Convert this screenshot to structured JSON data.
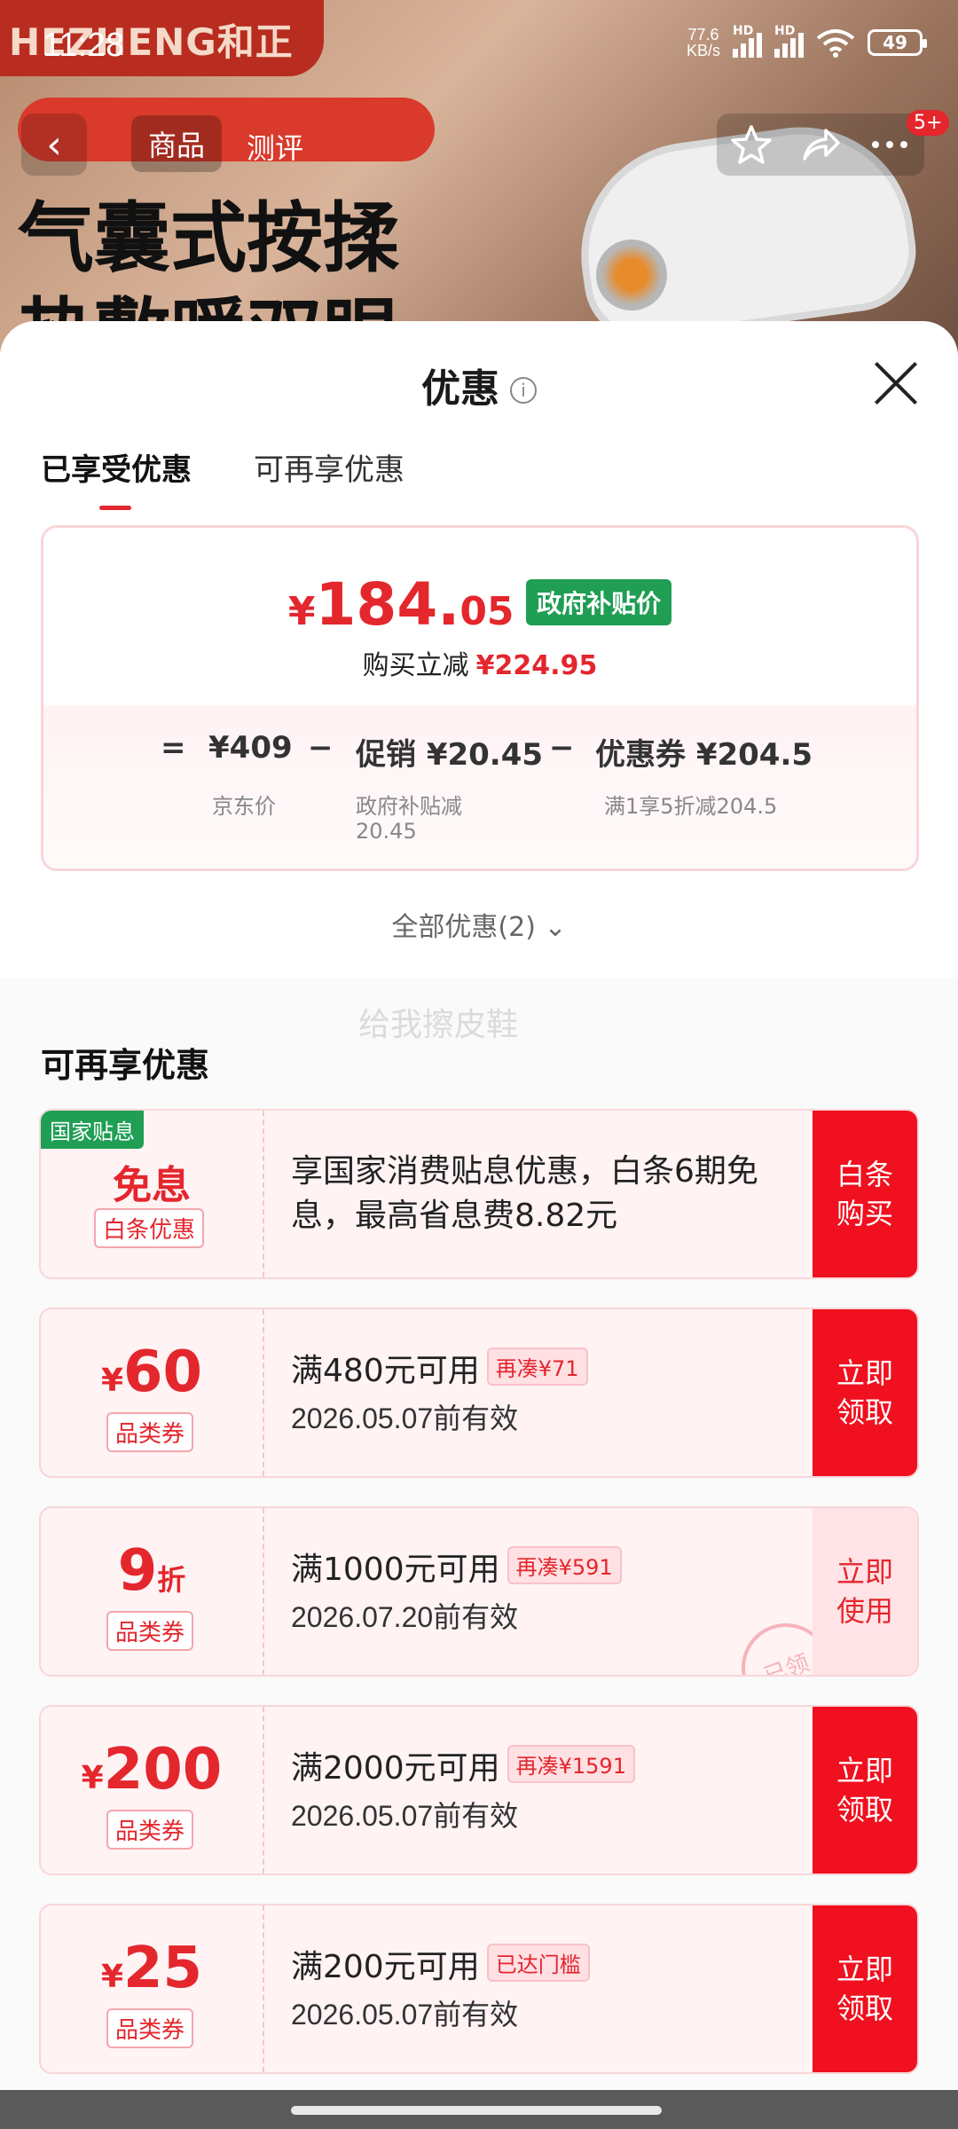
{
  "status": {
    "time": "11:28",
    "net_speed": "77.6",
    "net_unit": "KB/s",
    "hd1": "HD",
    "hd2": "HD",
    "wifi_sub": "6",
    "battery": "49"
  },
  "background": {
    "brand": "HEZHENG和正",
    "banner": "",
    "headline1": "气囊式按揉",
    "headline2": "热敷暖双眼"
  },
  "nav": {
    "back_icon": "‹",
    "tab_product": "商品",
    "tab_review": "测评",
    "badge": "5+"
  },
  "sheet": {
    "title": "优惠",
    "tabs": [
      "已享受优惠",
      "可再享优惠"
    ],
    "summary": {
      "price_yen": "¥",
      "price_int": "184.",
      "price_dec": "05",
      "gov_tag": "政府补贴价",
      "cut_label": "购买立减",
      "cut_amount": "¥224.95",
      "eq": "=",
      "jd_price": "¥409",
      "minus1": "−",
      "promo": "促销 ¥20.45",
      "minus2": "−",
      "coupon": "优惠券 ¥204.5",
      "jd_label": "京东价",
      "promo_sub1": "政府补贴减",
      "promo_sub2": "20.45",
      "coupon_sub": "满1享5折减204.5"
    },
    "all_offers": "全部优惠(2)",
    "ghost": "给我擦皮鞋",
    "section_title": "可再享优惠",
    "national": {
      "tag": "国家贴息",
      "main": "免息",
      "sub": "白条优惠",
      "desc": "享国家消费贴息优惠，白条6期免息，最高省息费8.82元",
      "action": "白条\n购买"
    },
    "coupons": [
      {
        "yen": "¥",
        "num": "60",
        "unit": "",
        "type": "品类券",
        "cond": "满480元可用",
        "tag": "再凑¥71",
        "expiry": "2026.05.07前有效",
        "action": "立即领取"
      },
      {
        "yen": "",
        "num": "9",
        "unit": "折",
        "type": "品类券",
        "cond": "满1000元可用",
        "tag": "再凑¥591",
        "expiry": "2026.07.20前有效",
        "action": "立即使用",
        "stamp": "已领"
      },
      {
        "yen": "¥",
        "num": "200",
        "unit": "",
        "type": "品类券",
        "cond": "满2000元可用",
        "tag": "再凑¥1591",
        "expiry": "2026.05.07前有效",
        "action": "立即领取"
      },
      {
        "yen": "¥",
        "num": "25",
        "unit": "",
        "type": "品类券",
        "cond": "满200元可用",
        "tag": "已达门槛",
        "expiry": "2026.05.07前有效",
        "action": "立即领取"
      }
    ]
  },
  "colors": {
    "accent": "#e4262d",
    "green": "#1f9e54",
    "action_red": "#f0101f"
  }
}
